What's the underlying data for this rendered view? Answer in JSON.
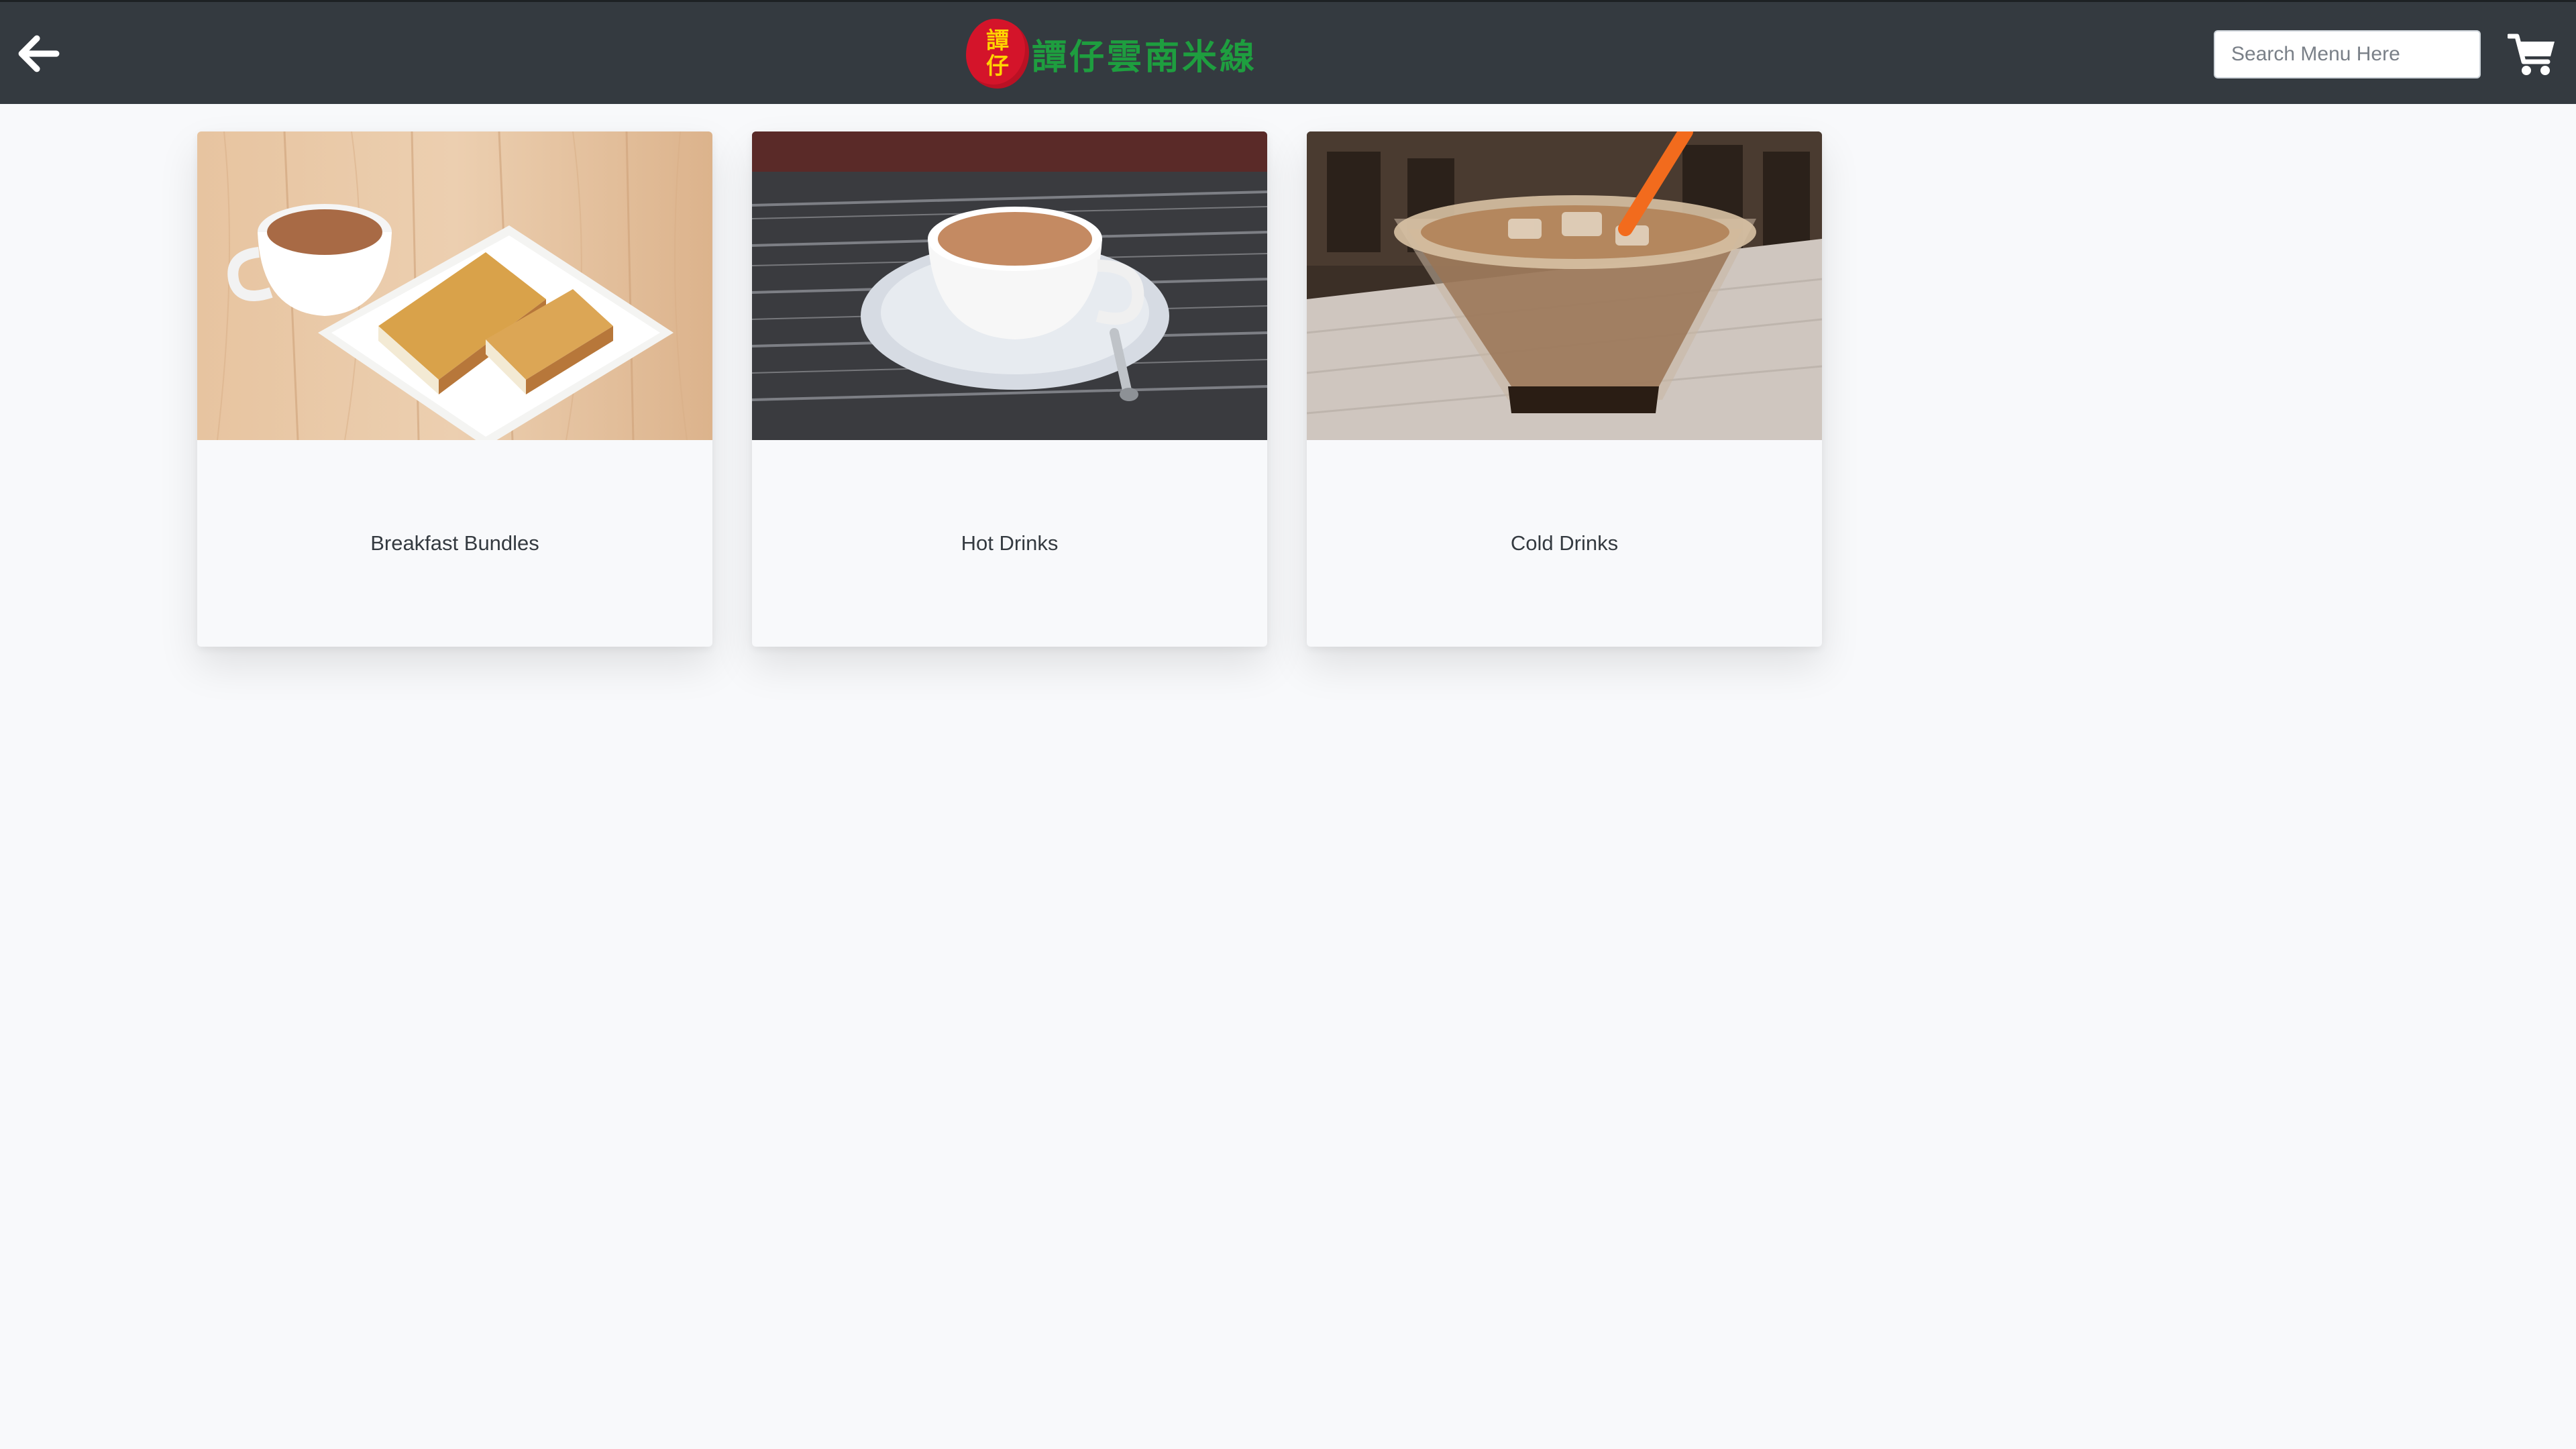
{
  "header": {
    "back_icon": "arrow-left-icon",
    "logo": {
      "seal_chars": [
        "譚",
        "仔"
      ],
      "brand_text": "譚仔雲南米線",
      "seal_color": "#d4142a",
      "text_color": "#1e9e3f"
    },
    "search": {
      "placeholder": "Search Menu Here",
      "value": ""
    },
    "cart_icon": "shopping-cart-icon"
  },
  "categories": [
    {
      "label": "Breakfast Bundles",
      "image": "milk-tea-and-toast-photo"
    },
    {
      "label": "Hot Drinks",
      "image": "hot-milk-tea-cup-photo"
    },
    {
      "label": "Cold Drinks",
      "image": "iced-milk-tea-glass-photo"
    }
  ],
  "colors": {
    "topbar": "#343a40",
    "page_background": "#f8f9fb",
    "card_background": "#f8f9fb",
    "text": "#343a40"
  }
}
